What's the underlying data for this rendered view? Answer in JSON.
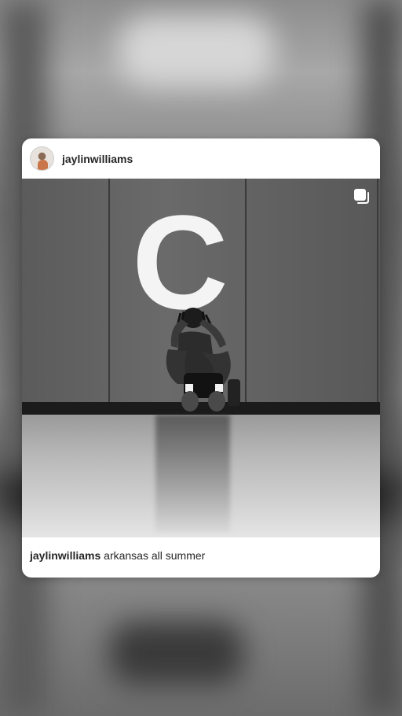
{
  "post": {
    "username": "jaylinwilliams",
    "caption_user": "jaylinwilliams",
    "caption_text": "arkansas all summer",
    "wall_letter": "C"
  },
  "icons": {
    "multi_media": "carousel-icon",
    "avatar": "avatar"
  },
  "colors": {
    "card_background": "#ffffff",
    "text": "#262626"
  }
}
